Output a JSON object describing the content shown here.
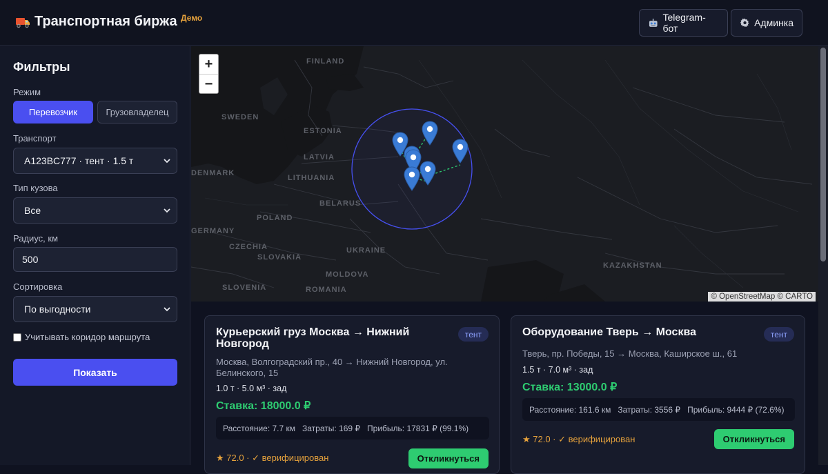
{
  "header": {
    "title": "Транспортная биржа",
    "badge": "Демо",
    "telegram_label": "Telegram-бот",
    "admin_label": "Админка"
  },
  "filters": {
    "title": "Фильтры",
    "mode_label": "Режим",
    "mode_options": [
      "Перевозчик",
      "Грузовладелец"
    ],
    "transport_label": "Транспорт",
    "transport_value": "A123BC777 · тент · 1.5 т",
    "body_label": "Тип кузова",
    "body_value": "Все",
    "radius_label": "Радиус, км",
    "radius_value": "500",
    "sort_label": "Сортировка",
    "sort_value": "По выгодности",
    "corridor_label": "Учитывать коридор маршрута",
    "show_label": "Показать"
  },
  "map": {
    "zoom_in": "+",
    "zoom_out": "−",
    "attribution": "© OpenStreetMap © CARTO",
    "countries": [
      "FINLAND",
      "SWEDEN",
      "ESTONIA",
      "LATVIA",
      "DENMARK",
      "LITHUANIA",
      "BELARUS",
      "POLAND",
      "GERMANY",
      "CZECHIA",
      "SLOVAKIA",
      "UKRAINE",
      "MOLDOVA",
      "ROMANIA",
      "SLOVENIA",
      "KAZAKHSTAN"
    ]
  },
  "cards": [
    {
      "title": "Курьерский груз Москва → Нижний Новгород",
      "tag": "тент",
      "address": "Москва, Волгоградский пр., 40 → Нижний Новгород, ул. Белинского, 15",
      "specs": "1.0 т · 5.0 м³ · зад",
      "rate": "Ставка: 18000.0 ₽",
      "distance": "Расстояние: 7.7 км",
      "costs": "Затраты: 169 ₽",
      "profit": "Прибыль: 17831 ₽ (99.1%)",
      "rating": "★ 72.0 · ✓ верифицирован",
      "respond": "Откликнуться"
    },
    {
      "title": "Оборудование Тверь → Москва",
      "tag": "тент",
      "address": "Тверь, пр. Победы, 15 → Москва, Каширское ш., 61",
      "specs": "1.5 т · 7.0 м³ · зад",
      "rate": "Ставка: 13000.0 ₽",
      "distance": "Расстояние: 161.6 км",
      "costs": "Затраты: 3556 ₽",
      "profit": "Прибыль: 9444 ₽ (72.6%)",
      "rating": "★ 72.0 · ✓ верифицирован",
      "respond": "Откликнуться"
    }
  ],
  "colors": {
    "accent": "#4a4ff0",
    "success": "#2ecc71",
    "warning": "#e6a23c",
    "tag": "#8ea2ff"
  }
}
